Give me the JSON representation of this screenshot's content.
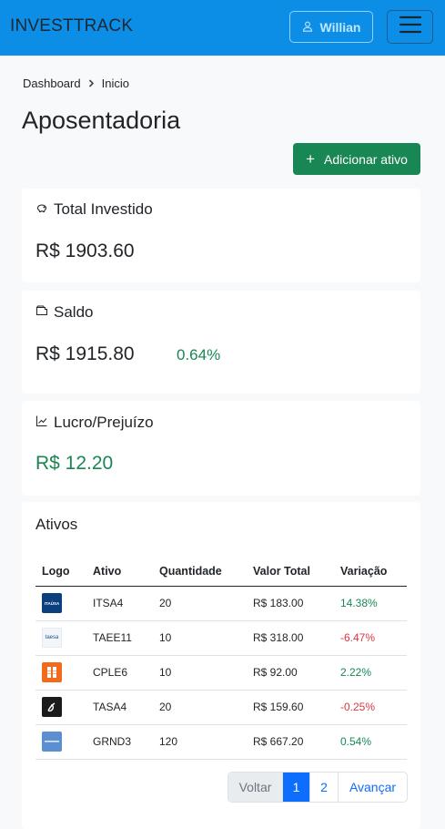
{
  "navbar": {
    "brand": "INVESTTRACK",
    "user_label": "Willian"
  },
  "breadcrumb": {
    "items": [
      "Dashboard",
      "Inicio"
    ]
  },
  "page_title": "Aposentadoria",
  "add_button": "Adicionar ativo",
  "cards": {
    "total_investido": {
      "title": "Total Investido",
      "value": "R$ 1903.60"
    },
    "saldo": {
      "title": "Saldo",
      "value": "R$ 1915.80",
      "percent": "0.64%"
    },
    "lucro": {
      "title": "Lucro/Prejuízo",
      "value": "R$ 12.20"
    }
  },
  "ativos": {
    "title": "Ativos",
    "columns": [
      "Logo",
      "Ativo",
      "Quantidade",
      "Valor Total",
      "Variação"
    ],
    "rows": [
      {
        "ativo": "ITSA4",
        "quantidade": "20",
        "valor": "R$ 183.00",
        "variacao": "14.38%"
      },
      {
        "ativo": "TAEE11",
        "quantidade": "10",
        "valor": "R$ 318.00",
        "variacao": "-6.47%"
      },
      {
        "ativo": "CPLE6",
        "quantidade": "10",
        "valor": "R$ 92.00",
        "variacao": "2.22%"
      },
      {
        "ativo": "TASA4",
        "quantidade": "20",
        "valor": "R$ 159.60",
        "variacao": "-0.25%"
      },
      {
        "ativo": "GRND3",
        "quantidade": "120",
        "valor": "R$ 667.20",
        "variacao": "0.54%"
      }
    ],
    "logo_text": {
      "itsa4": "ITAÚSA",
      "taee11": "taesa"
    }
  },
  "pagination": {
    "prev": "Voltar",
    "page1": "1",
    "page2": "2",
    "next": "Avançar"
  },
  "colors": {
    "navbar": "#0d8ee6",
    "success": "#198754",
    "danger": "#dc3545",
    "primary": "#0d6efd"
  }
}
